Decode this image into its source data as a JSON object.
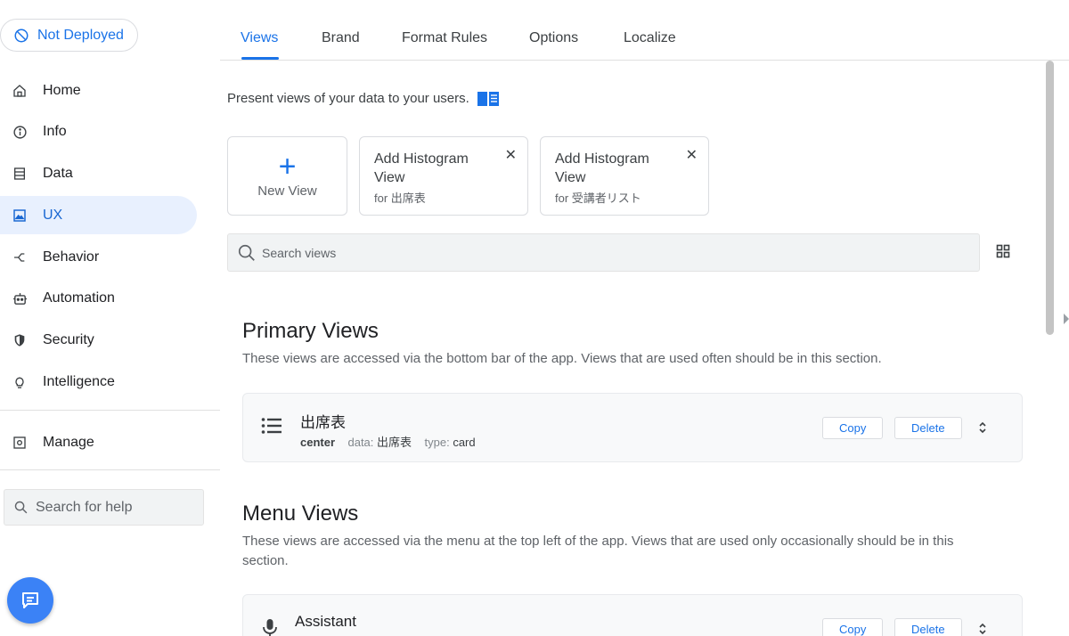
{
  "deploy_status": "Not Deployed",
  "sidebar": {
    "items": [
      {
        "label": "Home",
        "icon": "home-icon"
      },
      {
        "label": "Info",
        "icon": "info-icon"
      },
      {
        "label": "Data",
        "icon": "data-icon"
      },
      {
        "label": "UX",
        "icon": "ux-icon",
        "active": true
      },
      {
        "label": "Behavior",
        "icon": "behavior-icon"
      },
      {
        "label": "Automation",
        "icon": "automation-icon"
      },
      {
        "label": "Security",
        "icon": "shield-icon"
      },
      {
        "label": "Intelligence",
        "icon": "lightbulb-icon"
      }
    ],
    "manage_label": "Manage",
    "help_placeholder": "Search for help"
  },
  "tabs": [
    "Views",
    "Brand",
    "Format Rules",
    "Options",
    "Localize"
  ],
  "main": {
    "intro": "Present views of your data to your users.",
    "new_view_label": "New View",
    "suggestions": [
      {
        "title": "Add Histogram View",
        "subtitle": "for 出席表"
      },
      {
        "title": "Add Histogram View",
        "subtitle": "for 受講者リスト"
      }
    ],
    "search_placeholder": "Search views",
    "primary": {
      "title": "Primary Views",
      "desc": "These views are accessed via the bottom bar of the app. Views that are used often should be in this section.",
      "rows": [
        {
          "name": "出席表",
          "position": "center",
          "data_label": "data:",
          "data_value": "出席表",
          "type_label": "type:",
          "type_value": "card",
          "copy": "Copy",
          "delete": "Delete"
        }
      ]
    },
    "menu": {
      "title": "Menu Views",
      "desc": "These views are accessed via the menu at the top left of the app. Views that are used only occasionally should be in this section.",
      "rows": [
        {
          "name": "Assistant",
          "copy": "Copy",
          "delete": "Delete"
        }
      ]
    }
  },
  "colors": {
    "accent": "#1a73e8",
    "active_bg": "#e8f0fe",
    "fab": "#3b82f6"
  }
}
